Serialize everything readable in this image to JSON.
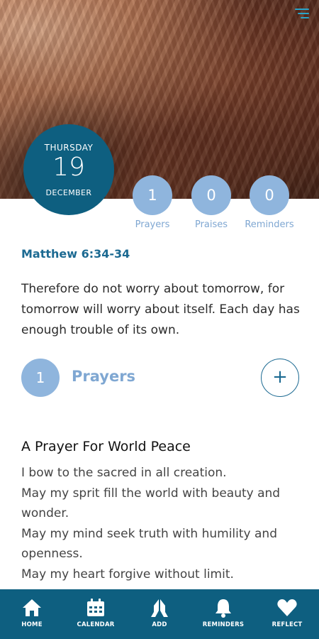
{
  "date": {
    "day_of_week": "THURSDAY",
    "day": "19",
    "month": "DECEMBER"
  },
  "counters": [
    {
      "count": "1",
      "label": "Prayers"
    },
    {
      "count": "0",
      "label": "Praises"
    },
    {
      "count": "0",
      "label": "Reminders"
    }
  ],
  "verse": {
    "reference": "Matthew 6:34-34",
    "text": "Therefore do not worry about tomorrow, for tomorrow will worry about itself. Each day has enough trouble of its own."
  },
  "section": {
    "count": "1",
    "title": "Prayers",
    "add_label": "+"
  },
  "prayer": {
    "title": "A Prayer For World Peace",
    "lines": [
      "I bow to the sacred in all creation.",
      "May my sprit fill the world with beauty and wonder.",
      "May my mind seek truth with humility and openness.",
      "May my heart forgive without limit."
    ]
  },
  "tabs": [
    {
      "label": "HOME",
      "icon": "home-icon"
    },
    {
      "label": "CALENDAR",
      "icon": "calendar-icon"
    },
    {
      "label": "ADD",
      "icon": "praying-hands-icon"
    },
    {
      "label": "REMINDERS",
      "icon": "bell-icon"
    },
    {
      "label": "REFLECT",
      "icon": "heart-icon"
    }
  ],
  "colors": {
    "primary": "#0e5f80",
    "accent_light": "#8fb5dd",
    "label_blue": "#7fa7d2",
    "menu_icon": "#2aa4c9"
  }
}
